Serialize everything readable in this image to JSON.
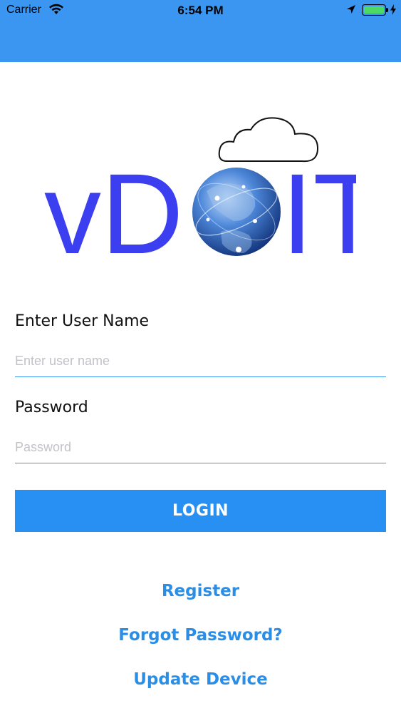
{
  "status_bar": {
    "carrier": "Carrier",
    "time": "6:54 PM"
  },
  "logo": {
    "text_left": "vD",
    "text_right": "IT",
    "brand_color": "#3b3ff0"
  },
  "form": {
    "username_label": "Enter User Name",
    "username_placeholder": "Enter user name",
    "password_label": "Password",
    "password_placeholder": "Password"
  },
  "login_label": "LOGIN",
  "links": {
    "register": "Register",
    "forgot_password": "Forgot Password?",
    "update_device": "Update Device"
  },
  "colors": {
    "header": "#3a96f0",
    "button": "#2890f2",
    "link": "#2a8ee6"
  }
}
